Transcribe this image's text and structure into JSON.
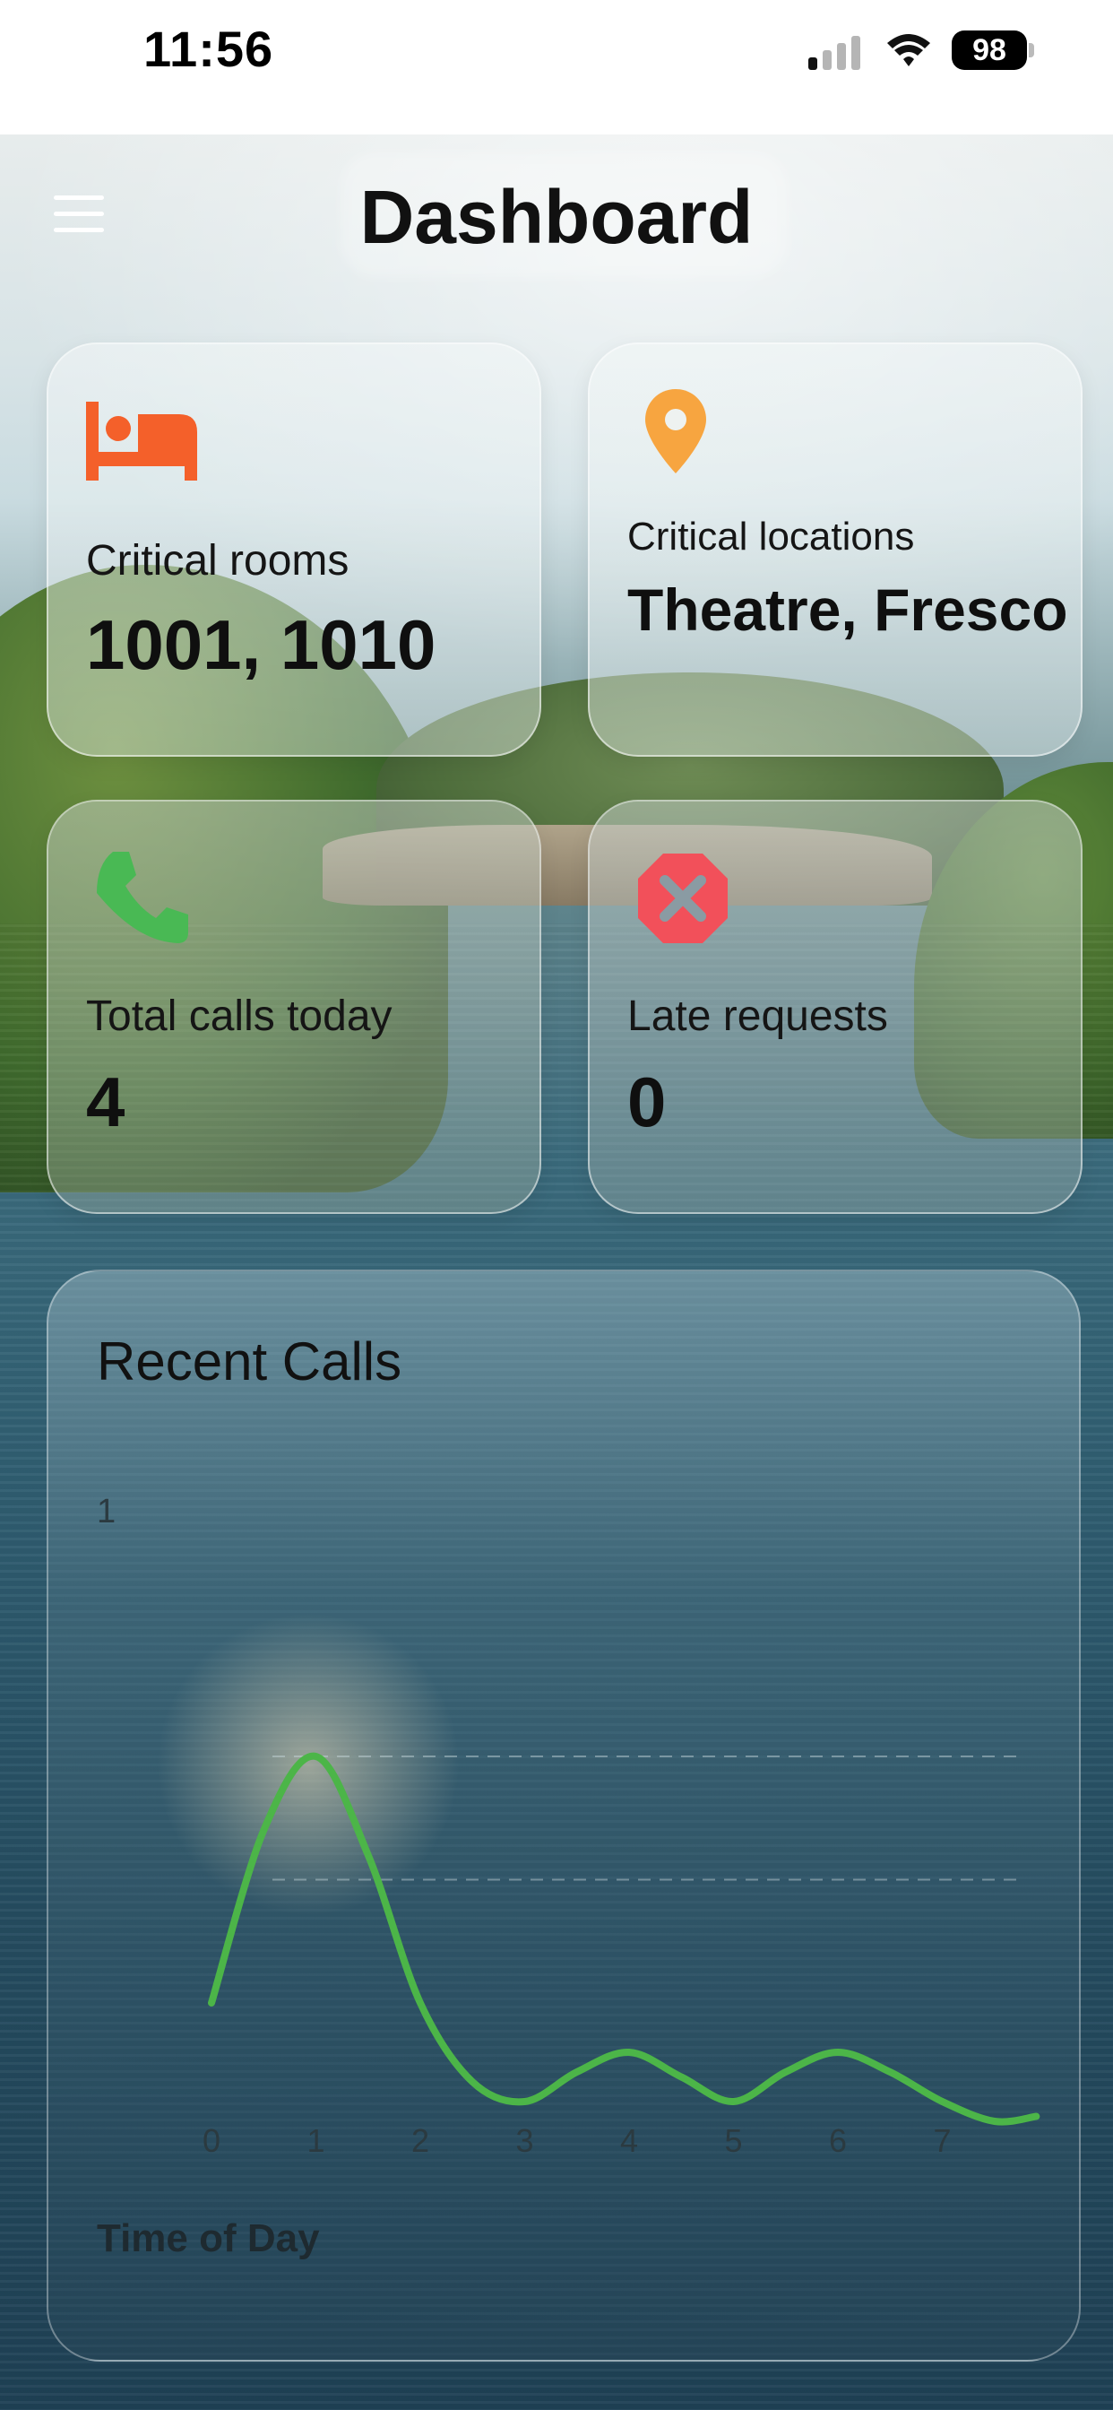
{
  "status_bar": {
    "time": "11:56",
    "battery": "98"
  },
  "header": {
    "title": "Dashboard",
    "menu_icon": "hamburger-menu-icon"
  },
  "cards": [
    {
      "icon": "bed-icon",
      "icon_color": "#F4602A",
      "label": "Critical rooms",
      "value": "1001, 1010"
    },
    {
      "icon": "location-pin-icon",
      "icon_color": "#F7A540",
      "label": "Critical locations",
      "value": "Theatre, Fresco"
    },
    {
      "icon": "phone-icon",
      "icon_color": "#49B954",
      "label": "Total calls today",
      "value": "4"
    },
    {
      "icon": "cancel-octagon-icon",
      "icon_color": "#F2505A",
      "label": "Late requests",
      "value": "0"
    }
  ],
  "chart_card": {
    "title": "Recent Calls",
    "chart_data": {
      "type": "line",
      "x": [
        0,
        0.5,
        1,
        1.5,
        2,
        2.5,
        3,
        3.5,
        4,
        4.5,
        5,
        5.5,
        6,
        6.5,
        7,
        7.5,
        7.9
      ],
      "series": [
        {
          "values": [
            0.0,
            0.35,
            0.5,
            0.3,
            0.0,
            -0.16,
            -0.2,
            -0.14,
            -0.1,
            -0.15,
            -0.2,
            -0.14,
            -0.1,
            -0.14,
            -0.2,
            -0.24,
            -0.23
          ],
          "color": "#4CB548"
        }
      ],
      "x_ticks": [
        "0",
        "1",
        "2",
        "3",
        "4",
        "5",
        "6",
        "7"
      ],
      "y_ticks": [
        "1"
      ],
      "xlabel": "Time of Day",
      "ylabel": "",
      "xlim": [
        0,
        7.9
      ],
      "ylim": [
        -0.3,
        1
      ],
      "grid": "dashed horizontal"
    }
  }
}
